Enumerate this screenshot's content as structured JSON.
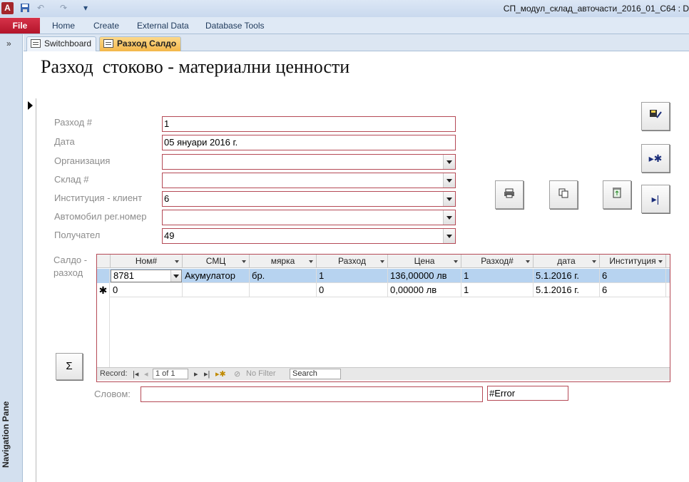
{
  "window": {
    "app_logo": "A",
    "title": "СП_модул_склад_авточасти_2016_01_С64 : D"
  },
  "ribbon": {
    "file": "File",
    "tabs": [
      "Home",
      "Create",
      "External Data",
      "Database Tools"
    ]
  },
  "nav_pane": {
    "toggle": "»",
    "label": "Navigation Pane"
  },
  "doc_tabs": [
    "Switchboard",
    "Разход Салдо"
  ],
  "form": {
    "title": "Разход  стоково - материални ценности",
    "fields": [
      {
        "label": "Разход #",
        "value": ""
      },
      {
        "label": "Дата",
        "value": "05 януари 2016 г."
      },
      {
        "label": "Организация",
        "value": ""
      },
      {
        "label": "Склад #",
        "value": ""
      },
      {
        "label": "Институция - клиент",
        "value": "6"
      },
      {
        "label": "Автомобил рег.номер",
        "value": ""
      },
      {
        "label": "Получател",
        "value": "49"
      }
    ],
    "record_id": "1",
    "slovom_label": "Словом:",
    "error_text": "#Error",
    "sum_symbol": "Σ"
  },
  "subform": {
    "label": "Салдо - разход",
    "columns": [
      "Ном#",
      "СМЦ",
      "мярка",
      "Разход",
      "Цена",
      "Разход#",
      "дата",
      "Институция"
    ],
    "rows": [
      [
        "8781",
        "Акумулатор",
        "бр.",
        "1",
        "136,00000 лв",
        "1",
        "5.1.2016 г.",
        "6"
      ],
      [
        "0",
        "",
        "",
        "0",
        "0,00000 лв",
        "1",
        "5.1.2016 г.",
        "6"
      ]
    ],
    "new_row_marker": "✱",
    "nav": {
      "record_label": "Record:",
      "record_value": "1 of 1",
      "filter": "No Filter",
      "search": "Search"
    }
  }
}
